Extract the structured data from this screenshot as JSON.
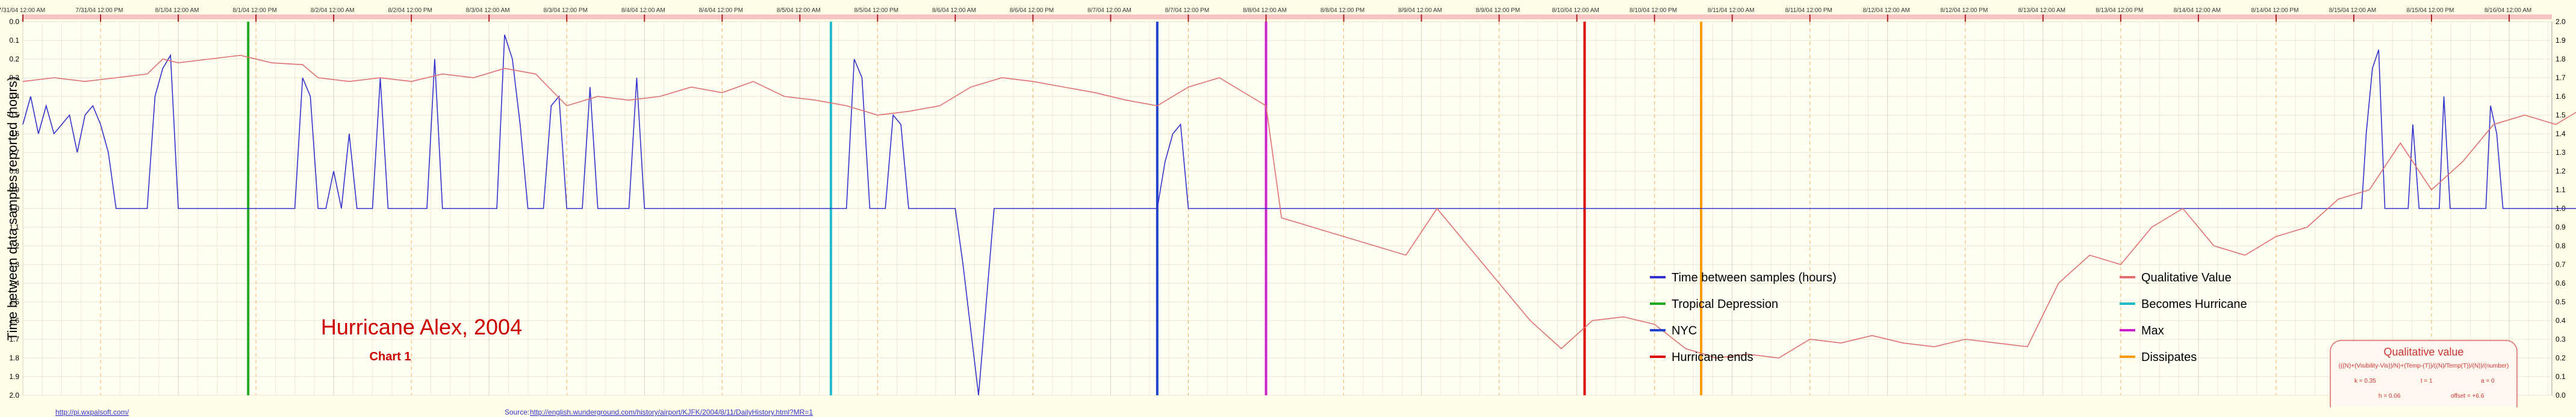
{
  "chart_data": {
    "type": "line",
    "title": "Hurricane Alex, 2004",
    "subtitle": "Chart 1",
    "ylabel": "Time between data samples reported (hours)",
    "ylim_left": [
      0.0,
      2.0
    ],
    "ylim_left_inverted": true,
    "ylim_right": [
      0.0,
      2.0
    ],
    "y_ticks_left": [
      "0.0",
      "0.1",
      "0.2",
      "0.3",
      "0.4",
      "0.5",
      "0.6",
      "0.7",
      "0.8",
      "0.9",
      "1.0",
      "1.1",
      "1.2",
      "1.3",
      "1.4",
      "1.5",
      "1.6",
      "1.7",
      "1.8",
      "1.9",
      "2.0"
    ],
    "y_ticks_right": [
      "2.0",
      "1.9",
      "1.8",
      "1.7",
      "1.6",
      "1.5",
      "1.4",
      "1.3",
      "1.2",
      "1.1",
      "1.0",
      "0.9",
      "0.8",
      "0.7",
      "0.6",
      "0.5",
      "0.4",
      "0.3",
      "0.2",
      "0.1",
      "0.0"
    ],
    "x_ticks": [
      "7/31/04 12:00 AM",
      "7/31/04 12:00 PM",
      "8/1/04 12:00 AM",
      "8/1/04 12:00 PM",
      "8/2/04 12:00 AM",
      "8/2/04 12:00 PM",
      "8/3/04 12:00 AM",
      "8/3/04 12:00 PM",
      "8/4/04 12:00 AM",
      "8/4/04 12:00 PM",
      "8/5/04 12:00 AM",
      "8/5/04 12:00 PM",
      "8/6/04 12:00 AM",
      "8/6/04 12:00 PM",
      "8/7/04 12:00 AM",
      "8/7/04 12:00 PM",
      "8/8/04 12:00 AM",
      "8/8/04 12:00 PM",
      "8/9/04 12:00 AM",
      "8/9/04 12:00 PM",
      "8/10/04 12:00 AM",
      "8/10/04 12:00 PM",
      "8/11/04 12:00 AM",
      "8/11/04 12:00 PM",
      "8/12/04 12:00 AM",
      "8/12/04 12:00 PM",
      "8/13/04 12:00 AM",
      "8/13/04 12:00 PM",
      "8/14/04 12:00 AM",
      "8/14/04 12:00 PM",
      "8/15/04 12:00 AM",
      "8/15/04 12:00 PM",
      "8/16/04 12:00 AM"
    ],
    "x_range_days": [
      0,
      16
    ],
    "grid": true,
    "legend": [
      {
        "label": "Time between samples (hours)",
        "color": "#3333cc"
      },
      {
        "label": "Qualitative Value",
        "color": "#e07070"
      },
      {
        "label": "Tropical Depression",
        "color": "#22aa22"
      },
      {
        "label": "Becomes Hurricane",
        "color": "#22bbcc"
      },
      {
        "label": "NYC",
        "color": "#2244cc"
      },
      {
        "label": "Max",
        "color": "#cc22cc"
      },
      {
        "label": "Hurricane ends",
        "color": "#dd0000"
      },
      {
        "label": "Dissipates",
        "color": "#ff9900"
      }
    ],
    "events": [
      {
        "label": "Tropical Depression",
        "x_day": 1.45,
        "color": "#22aa22"
      },
      {
        "label": "Becomes Hurricane",
        "x_day": 5.2,
        "color": "#22bbcc"
      },
      {
        "label": "NYC",
        "x_day": 7.3,
        "color": "#2244cc"
      },
      {
        "label": "Max",
        "x_day": 8.0,
        "color": "#cc22cc"
      },
      {
        "label": "Hurricane ends",
        "x_day": 10.05,
        "color": "#dd0000"
      },
      {
        "label": "Dissipates",
        "x_day": 10.8,
        "color": "#ff9900"
      }
    ],
    "series": [
      {
        "name": "Time between samples (hours)",
        "color": "#3333cc",
        "axis": "left",
        "points": [
          [
            0.0,
            0.55
          ],
          [
            0.05,
            0.4
          ],
          [
            0.1,
            0.6
          ],
          [
            0.15,
            0.45
          ],
          [
            0.2,
            0.6
          ],
          [
            0.25,
            0.55
          ],
          [
            0.3,
            0.5
          ],
          [
            0.35,
            0.7
          ],
          [
            0.4,
            0.5
          ],
          [
            0.45,
            0.45
          ],
          [
            0.5,
            0.55
          ],
          [
            0.55,
            0.7
          ],
          [
            0.6,
            1.0
          ],
          [
            0.8,
            1.0
          ],
          [
            0.85,
            0.4
          ],
          [
            0.9,
            0.25
          ],
          [
            0.95,
            0.18
          ],
          [
            1.0,
            1.0
          ],
          [
            1.75,
            1.0
          ],
          [
            1.8,
            0.3
          ],
          [
            1.85,
            0.4
          ],
          [
            1.9,
            1.0
          ],
          [
            1.95,
            1.0
          ],
          [
            2.0,
            0.8
          ],
          [
            2.05,
            1.0
          ],
          [
            2.1,
            0.6
          ],
          [
            2.15,
            1.0
          ],
          [
            2.25,
            1.0
          ],
          [
            2.3,
            0.3
          ],
          [
            2.35,
            1.0
          ],
          [
            2.6,
            1.0
          ],
          [
            2.65,
            0.2
          ],
          [
            2.7,
            1.0
          ],
          [
            3.05,
            1.0
          ],
          [
            3.1,
            0.07
          ],
          [
            3.15,
            0.2
          ],
          [
            3.2,
            0.55
          ],
          [
            3.25,
            1.0
          ],
          [
            3.35,
            1.0
          ],
          [
            3.4,
            0.45
          ],
          [
            3.45,
            0.4
          ],
          [
            3.5,
            1.0
          ],
          [
            3.6,
            1.0
          ],
          [
            3.65,
            0.35
          ],
          [
            3.7,
            1.0
          ],
          [
            3.9,
            1.0
          ],
          [
            3.95,
            0.3
          ],
          [
            4.0,
            1.0
          ],
          [
            5.3,
            1.0
          ],
          [
            5.35,
            0.2
          ],
          [
            5.4,
            0.3
          ],
          [
            5.45,
            1.0
          ],
          [
            5.55,
            1.0
          ],
          [
            5.6,
            0.5
          ],
          [
            5.65,
            0.55
          ],
          [
            5.7,
            1.0
          ],
          [
            6.0,
            1.0
          ],
          [
            6.05,
            1.3
          ],
          [
            6.15,
            2.0
          ],
          [
            6.25,
            1.0
          ],
          [
            7.3,
            1.0
          ],
          [
            7.35,
            0.75
          ],
          [
            7.4,
            0.6
          ],
          [
            7.45,
            0.55
          ],
          [
            7.5,
            1.0
          ],
          [
            15.05,
            1.0
          ],
          [
            15.08,
            0.6
          ],
          [
            15.12,
            0.25
          ],
          [
            15.16,
            0.15
          ],
          [
            15.2,
            1.0
          ],
          [
            15.35,
            1.0
          ],
          [
            15.38,
            0.55
          ],
          [
            15.42,
            1.0
          ],
          [
            15.55,
            1.0
          ],
          [
            15.58,
            0.4
          ],
          [
            15.62,
            1.0
          ],
          [
            15.85,
            1.0
          ],
          [
            15.88,
            0.45
          ],
          [
            15.92,
            0.6
          ],
          [
            15.96,
            1.0
          ],
          [
            16.5,
            1.0
          ],
          [
            16.53,
            0.45
          ],
          [
            16.57,
            1.0
          ],
          [
            17.5,
            1.0
          ],
          [
            17.53,
            0.5
          ],
          [
            17.57,
            1.0
          ],
          [
            18.4,
            1.0
          ],
          [
            18.43,
            0.28
          ],
          [
            18.47,
            0.6
          ],
          [
            18.51,
            0.35
          ],
          [
            18.55,
            1.0
          ],
          [
            19.0,
            1.0
          ],
          [
            19.03,
            0.35
          ],
          [
            19.07,
            0.5
          ],
          [
            19.1,
            0.7
          ],
          [
            19.13,
            1.0
          ]
        ]
      },
      {
        "name": "Qualitative Value",
        "color": "#e07070",
        "axis": "left",
        "points": [
          [
            0.0,
            0.32
          ],
          [
            0.2,
            0.3
          ],
          [
            0.4,
            0.32
          ],
          [
            0.6,
            0.3
          ],
          [
            0.8,
            0.28
          ],
          [
            0.9,
            0.2
          ],
          [
            1.0,
            0.22
          ],
          [
            1.2,
            0.2
          ],
          [
            1.4,
            0.18
          ],
          [
            1.6,
            0.22
          ],
          [
            1.8,
            0.23
          ],
          [
            1.9,
            0.3
          ],
          [
            2.1,
            0.32
          ],
          [
            2.3,
            0.3
          ],
          [
            2.5,
            0.32
          ],
          [
            2.7,
            0.28
          ],
          [
            2.9,
            0.3
          ],
          [
            3.1,
            0.25
          ],
          [
            3.3,
            0.28
          ],
          [
            3.5,
            0.45
          ],
          [
            3.7,
            0.4
          ],
          [
            3.9,
            0.42
          ],
          [
            4.1,
            0.4
          ],
          [
            4.3,
            0.35
          ],
          [
            4.5,
            0.38
          ],
          [
            4.7,
            0.32
          ],
          [
            4.9,
            0.4
          ],
          [
            5.1,
            0.42
          ],
          [
            5.3,
            0.45
          ],
          [
            5.5,
            0.5
          ],
          [
            5.7,
            0.48
          ],
          [
            5.9,
            0.45
          ],
          [
            6.1,
            0.35
          ],
          [
            6.3,
            0.3
          ],
          [
            6.5,
            0.32
          ],
          [
            6.7,
            0.35
          ],
          [
            6.9,
            0.38
          ],
          [
            7.1,
            0.42
          ],
          [
            7.3,
            0.45
          ],
          [
            7.5,
            0.35
          ],
          [
            7.7,
            0.3
          ],
          [
            7.9,
            0.4
          ],
          [
            8.0,
            0.45
          ],
          [
            8.1,
            1.05
          ],
          [
            8.3,
            1.1
          ],
          [
            8.5,
            1.15
          ],
          [
            8.7,
            1.2
          ],
          [
            8.9,
            1.25
          ],
          [
            9.1,
            1.0
          ],
          [
            9.3,
            1.2
          ],
          [
            9.5,
            1.4
          ],
          [
            9.7,
            1.6
          ],
          [
            9.9,
            1.75
          ],
          [
            10.1,
            1.6
          ],
          [
            10.3,
            1.58
          ],
          [
            10.5,
            1.62
          ],
          [
            10.7,
            1.75
          ],
          [
            10.9,
            1.8
          ],
          [
            11.1,
            1.78
          ],
          [
            11.3,
            1.8
          ],
          [
            11.5,
            1.7
          ],
          [
            11.7,
            1.72
          ],
          [
            11.9,
            1.68
          ],
          [
            12.1,
            1.72
          ],
          [
            12.3,
            1.74
          ],
          [
            12.5,
            1.7
          ],
          [
            12.7,
            1.72
          ],
          [
            12.9,
            1.74
          ],
          [
            13.1,
            1.4
          ],
          [
            13.3,
            1.25
          ],
          [
            13.5,
            1.3
          ],
          [
            13.7,
            1.1
          ],
          [
            13.9,
            1.0
          ],
          [
            14.1,
            1.2
          ],
          [
            14.3,
            1.25
          ],
          [
            14.5,
            1.15
          ],
          [
            14.7,
            1.1
          ],
          [
            14.9,
            0.95
          ],
          [
            15.1,
            0.9
          ],
          [
            15.3,
            0.65
          ],
          [
            15.5,
            0.9
          ],
          [
            15.7,
            0.75
          ],
          [
            15.9,
            0.55
          ],
          [
            16.1,
            0.5
          ],
          [
            16.3,
            0.55
          ],
          [
            16.5,
            0.45
          ],
          [
            16.7,
            0.5
          ],
          [
            16.9,
            0.42
          ],
          [
            17.1,
            0.5
          ],
          [
            17.3,
            0.45
          ],
          [
            17.5,
            0.38
          ],
          [
            17.7,
            0.45
          ],
          [
            17.9,
            0.5
          ],
          [
            18.1,
            0.4
          ],
          [
            18.3,
            0.45
          ],
          [
            18.5,
            0.35
          ],
          [
            18.7,
            0.45
          ],
          [
            18.9,
            0.7
          ],
          [
            19.1,
            0.72
          ],
          [
            19.3,
            0.55
          ],
          [
            19.5,
            0.7
          ],
          [
            19.7,
            0.75
          ],
          [
            19.9,
            0.78
          ],
          [
            20.1,
            0.7
          ],
          [
            20.3,
            0.75
          ],
          [
            20.5,
            0.65
          ],
          [
            20.7,
            0.7
          ]
        ]
      }
    ]
  },
  "legend_title": "Qualitative value",
  "legend_formula": "(((N)+(Visibility-Vis))/N)+(Temp-(T))/((N)/Temp(T))/(N))/(number)",
  "legend_params": [
    {
      "k": "k = 0.35"
    },
    {
      "t": "t = 1"
    },
    {
      "a": "a = 0"
    },
    {
      "h": "h = 0.06"
    },
    {
      "offset": "offset = +6.6"
    }
  ],
  "footer": {
    "left_link": "http://pi.wxpalsoft.com/",
    "source_label": "Source:",
    "source_url": "http://english.wunderground.com/history/airport/KJFK/2004/8/11/DailyHistory.html?MR=1"
  }
}
